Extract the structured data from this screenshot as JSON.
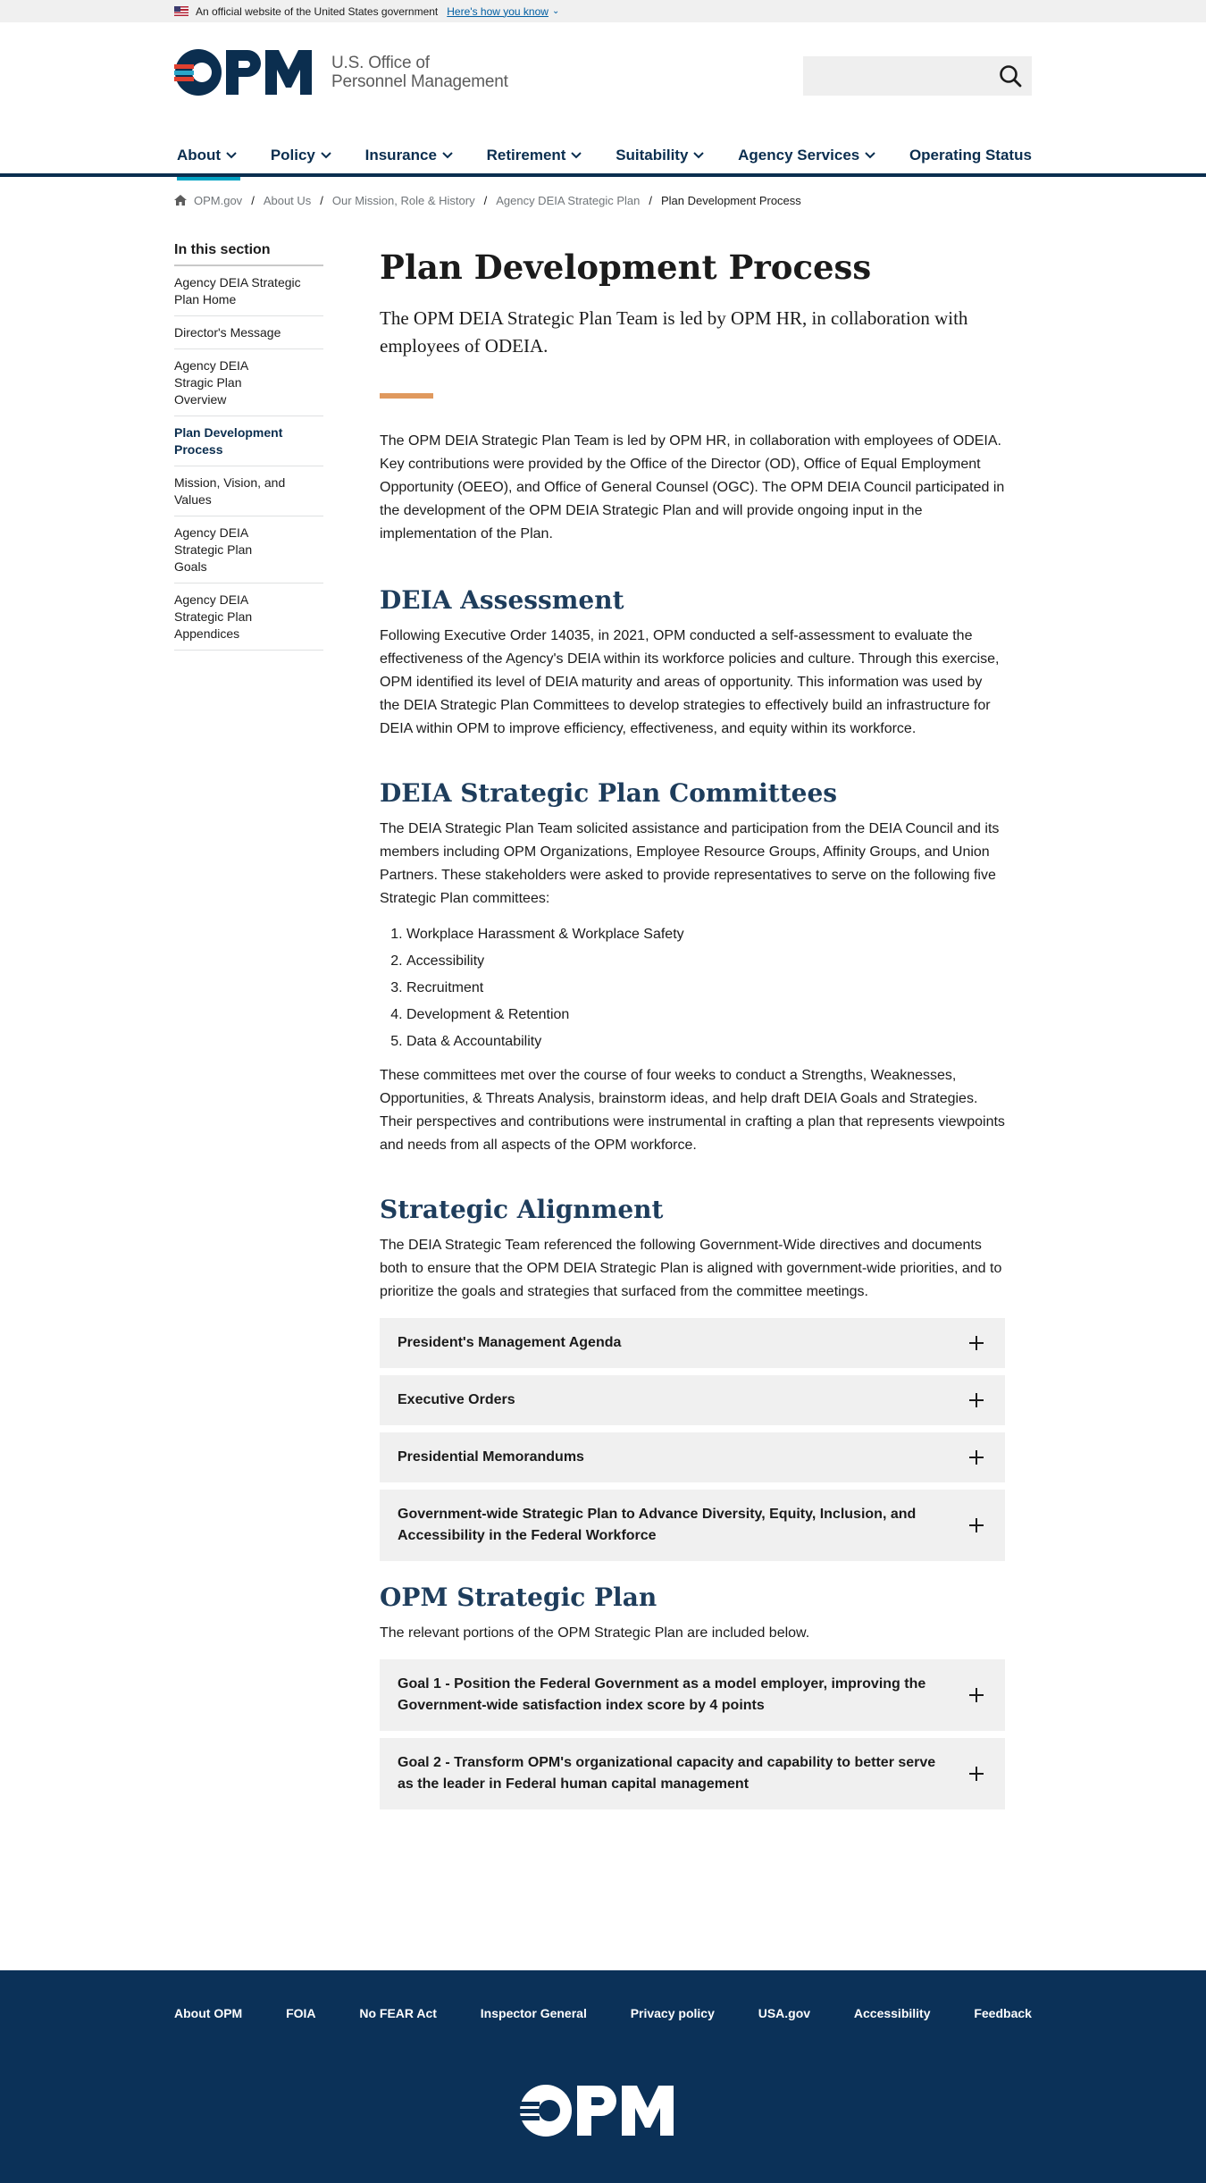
{
  "gov_banner": {
    "text": "An official website of the United States government",
    "how_link": "Here's how you know"
  },
  "header": {
    "logo_text_line1": "U.S. Office of",
    "logo_text_line2": "Personnel Management",
    "search_placeholder": ""
  },
  "nav": {
    "items": [
      {
        "label": "About"
      },
      {
        "label": "Policy"
      },
      {
        "label": "Insurance"
      },
      {
        "label": "Retirement"
      },
      {
        "label": "Suitability"
      },
      {
        "label": "Agency Services"
      },
      {
        "label": "Operating Status"
      }
    ]
  },
  "breadcrumb": {
    "items": [
      "OPM.gov",
      "About Us",
      "Our Mission, Role & History",
      "Agency DEIA Strategic Plan"
    ],
    "current": "Plan Development Process"
  },
  "sidebar": {
    "title": "In this section",
    "items": [
      {
        "label": "Agency DEIA Strategic Plan Home"
      },
      {
        "label": "Director's Message"
      },
      {
        "label": "Agency DEIA Stragic Plan Overview"
      },
      {
        "label": "Plan Development Process"
      },
      {
        "label": "Mission, Vision, and Values"
      },
      {
        "label": "Agency DEIA Strategic Plan Goals"
      },
      {
        "label": "Agency DEIA Strategic Plan Appendices"
      }
    ]
  },
  "main": {
    "title": "Plan Development Process",
    "lead": "The OPM DEIA Strategic Plan Team is led by OPM HR, in collaboration with employees of ODEIA.",
    "intro": "The OPM DEIA Strategic Plan Team is led by OPM HR, in collaboration with employees of ODEIA. Key contributions were provided by the Office of the Director (OD), Office of Equal Employment Opportunity (OEEO), and Office of General Counsel (OGC). The OPM DEIA Council participated in the development of the OPM DEIA Strategic Plan and will provide ongoing input in the implementation of the Plan.",
    "assessment_heading": "DEIA Assessment",
    "assessment_text": "Following Executive Order 14035, in 2021, OPM conducted a self-assessment to evaluate the effectiveness of the Agency's DEIA within its workforce policies and culture. Through this exercise, OPM identified its level of DEIA maturity and areas of opportunity. This information was used by the DEIA Strategic Plan Committees to develop strategies to effectively build an infrastructure for DEIA within OPM to improve efficiency, effectiveness, and equity within its workforce.",
    "committees_heading": "DEIA Strategic Plan Committees",
    "committees_text": "The DEIA Strategic Plan Team solicited assistance and participation from the DEIA Council and its members including OPM Organizations, Employee Resource Groups, Affinity Groups, and Union Partners. These stakeholders were asked to provide representatives to serve on the following five Strategic Plan committees:",
    "committees_list": [
      "Workplace Harassment & Workplace Safety",
      "Accessibility",
      "Recruitment",
      "Development & Retention",
      "Data & Accountability"
    ],
    "committees_text2": "These committees met over the course of four weeks to conduct a Strengths, Weaknesses, Opportunities, & Threats Analysis, brainstorm ideas, and help draft DEIA Goals and Strategies. Their perspectives and contributions were instrumental in crafting a plan that represents viewpoints and needs from all aspects of the OPM workforce.",
    "alignment_heading": "Strategic Alignment",
    "alignment_text": "The DEIA Strategic Team referenced the following Government-Wide directives and documents both to ensure that the OPM DEIA Strategic Plan is aligned with government-wide priorities, and to prioritize the goals and strategies that surfaced from the committee meetings.",
    "alignment_accordions": [
      "President's Management Agenda",
      "Executive Orders",
      "Presidential Memorandums",
      "Government-wide Strategic Plan to Advance Diversity, Equity, Inclusion, and Accessibility in the Federal Workforce"
    ],
    "opm_plan_heading": "OPM Strategic Plan",
    "opm_plan_text": "The relevant portions of the OPM Strategic Plan are included below.",
    "opm_plan_accordions": [
      "Goal 1 - Position the Federal Government as a model employer, improving the Government-wide satisfaction index score by 4 points",
      "Goal 2 - Transform OPM's organizational capacity and capability to better serve as the leader in Federal human capital management"
    ]
  },
  "footer": {
    "links": [
      "About OPM",
      "FOIA",
      "No FEAR Act",
      "Inspector General",
      "Privacy policy",
      "USA.gov",
      "Accessibility",
      "Feedback"
    ]
  },
  "colors": {
    "navy": "#0b2e4f",
    "heading_blue": "#1e3d5c",
    "accent_orange": "#e0995e",
    "active_tab": "#00a3c4",
    "footer_bg": "#0b3158"
  }
}
